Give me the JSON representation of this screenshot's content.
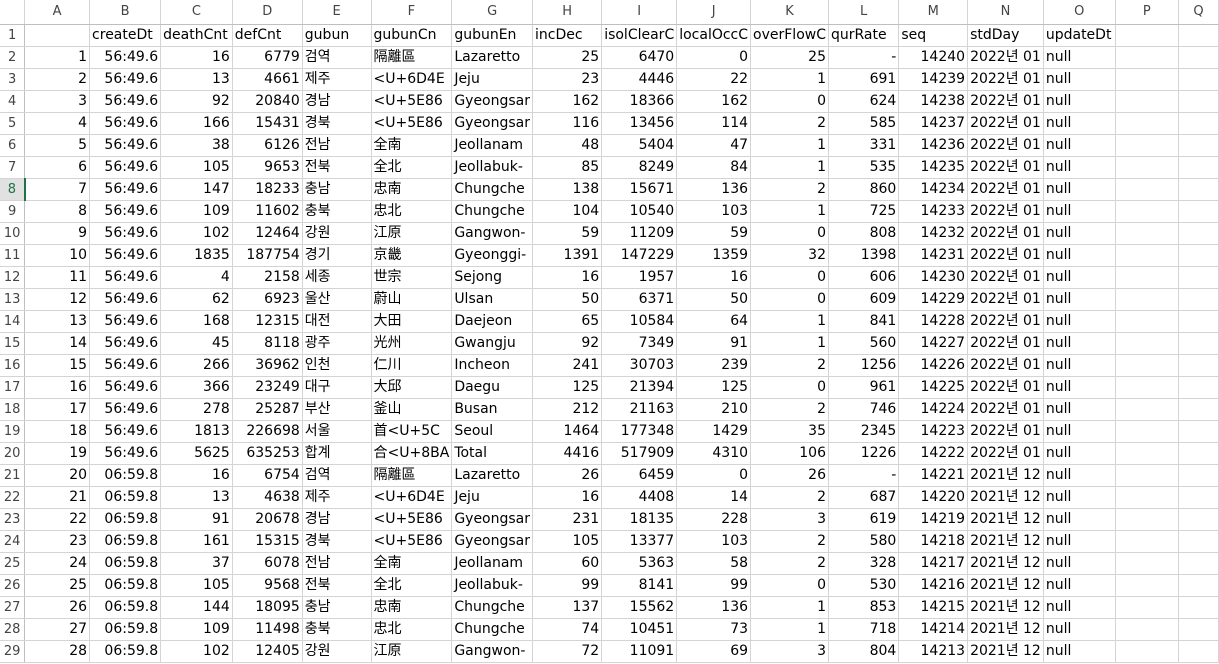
{
  "sheet": {
    "column_letters": [
      "A",
      "B",
      "C",
      "D",
      "E",
      "F",
      "G",
      "H",
      "I",
      "J",
      "K",
      "L",
      "M",
      "N",
      "O",
      "P",
      "Q"
    ],
    "header_row": [
      "",
      "createDt",
      "deathCnt",
      "defCnt",
      "gubun",
      "gubunCn",
      "gubunEn",
      "incDec",
      "isolClearC",
      "localOccC",
      "overFlowC",
      "qurRate",
      "seq",
      "stdDay",
      "updateDt",
      "",
      ""
    ],
    "selected_row": 8,
    "rows": [
      [
        "1",
        "56:49.6",
        "16",
        "6779",
        "검역",
        "隔離區",
        "Lazaretto",
        "25",
        "6470",
        "0",
        "25",
        "-",
        "14240",
        "2022년 01",
        "null"
      ],
      [
        "2",
        "56:49.6",
        "13",
        "4661",
        "제주",
        "<U+6D4E",
        "Jeju",
        "23",
        "4446",
        "22",
        "1",
        "691",
        "14239",
        "2022년 01",
        "null"
      ],
      [
        "3",
        "56:49.6",
        "92",
        "20840",
        "경남",
        "<U+5E86",
        "Gyeongsar",
        "162",
        "18366",
        "162",
        "0",
        "624",
        "14238",
        "2022년 01",
        "null"
      ],
      [
        "4",
        "56:49.6",
        "166",
        "15431",
        "경북",
        "<U+5E86",
        "Gyeongsar",
        "116",
        "13456",
        "114",
        "2",
        "585",
        "14237",
        "2022년 01",
        "null"
      ],
      [
        "5",
        "56:49.6",
        "38",
        "6126",
        "전남",
        "全南",
        "Jeollanam",
        "48",
        "5404",
        "47",
        "1",
        "331",
        "14236",
        "2022년 01",
        "null"
      ],
      [
        "6",
        "56:49.6",
        "105",
        "9653",
        "전북",
        "全北",
        "Jeollabuk-",
        "85",
        "8249",
        "84",
        "1",
        "535",
        "14235",
        "2022년 01",
        "null"
      ],
      [
        "7",
        "56:49.6",
        "147",
        "18233",
        "충남",
        "忠南",
        "Chungche",
        "138",
        "15671",
        "136",
        "2",
        "860",
        "14234",
        "2022년 01",
        "null"
      ],
      [
        "8",
        "56:49.6",
        "109",
        "11602",
        "충북",
        "忠北",
        "Chungche",
        "104",
        "10540",
        "103",
        "1",
        "725",
        "14233",
        "2022년 01",
        "null"
      ],
      [
        "9",
        "56:49.6",
        "102",
        "12464",
        "강원",
        "江原",
        "Gangwon-",
        "59",
        "11209",
        "59",
        "0",
        "808",
        "14232",
        "2022년 01",
        "null"
      ],
      [
        "10",
        "56:49.6",
        "1835",
        "187754",
        "경기",
        "京畿",
        "Gyeonggi-",
        "1391",
        "147229",
        "1359",
        "32",
        "1398",
        "14231",
        "2022년 01",
        "null"
      ],
      [
        "11",
        "56:49.6",
        "4",
        "2158",
        "세종",
        "世宗",
        "Sejong",
        "16",
        "1957",
        "16",
        "0",
        "606",
        "14230",
        "2022년 01",
        "null"
      ],
      [
        "12",
        "56:49.6",
        "62",
        "6923",
        "울산",
        "蔚山",
        "Ulsan",
        "50",
        "6371",
        "50",
        "0",
        "609",
        "14229",
        "2022년 01",
        "null"
      ],
      [
        "13",
        "56:49.6",
        "168",
        "12315",
        "대전",
        "大田",
        "Daejeon",
        "65",
        "10584",
        "64",
        "1",
        "841",
        "14228",
        "2022년 01",
        "null"
      ],
      [
        "14",
        "56:49.6",
        "45",
        "8118",
        "광주",
        "光州",
        "Gwangju",
        "92",
        "7349",
        "91",
        "1",
        "560",
        "14227",
        "2022년 01",
        "null"
      ],
      [
        "15",
        "56:49.6",
        "266",
        "36962",
        "인천",
        "仁川",
        "Incheon",
        "241",
        "30703",
        "239",
        "2",
        "1256",
        "14226",
        "2022년 01",
        "null"
      ],
      [
        "16",
        "56:49.6",
        "366",
        "23249",
        "대구",
        "大邱",
        "Daegu",
        "125",
        "21394",
        "125",
        "0",
        "961",
        "14225",
        "2022년 01",
        "null"
      ],
      [
        "17",
        "56:49.6",
        "278",
        "25287",
        "부산",
        "釜山",
        "Busan",
        "212",
        "21163",
        "210",
        "2",
        "746",
        "14224",
        "2022년 01",
        "null"
      ],
      [
        "18",
        "56:49.6",
        "1813",
        "226698",
        "서울",
        "首<U+5C",
        "Seoul",
        "1464",
        "177348",
        "1429",
        "35",
        "2345",
        "14223",
        "2022년 01",
        "null"
      ],
      [
        "19",
        "56:49.6",
        "5625",
        "635253",
        "합계",
        "合<U+8BA",
        "Total",
        "4416",
        "517909",
        "4310",
        "106",
        "1226",
        "14222",
        "2022년 01",
        "null"
      ],
      [
        "20",
        "06:59.8",
        "16",
        "6754",
        "검역",
        "隔離區",
        "Lazaretto",
        "26",
        "6459",
        "0",
        "26",
        "-",
        "14221",
        "2021년 12",
        "null"
      ],
      [
        "21",
        "06:59.8",
        "13",
        "4638",
        "제주",
        "<U+6D4E",
        "Jeju",
        "16",
        "4408",
        "14",
        "2",
        "687",
        "14220",
        "2021년 12",
        "null"
      ],
      [
        "22",
        "06:59.8",
        "91",
        "20678",
        "경남",
        "<U+5E86",
        "Gyeongsar",
        "231",
        "18135",
        "228",
        "3",
        "619",
        "14219",
        "2021년 12",
        "null"
      ],
      [
        "23",
        "06:59.8",
        "161",
        "15315",
        "경북",
        "<U+5E86",
        "Gyeongsar",
        "105",
        "13377",
        "103",
        "2",
        "580",
        "14218",
        "2021년 12",
        "null"
      ],
      [
        "24",
        "06:59.8",
        "37",
        "6078",
        "전남",
        "全南",
        "Jeollanam",
        "60",
        "5363",
        "58",
        "2",
        "328",
        "14217",
        "2021년 12",
        "null"
      ],
      [
        "25",
        "06:59.8",
        "105",
        "9568",
        "전북",
        "全北",
        "Jeollabuk-",
        "99",
        "8141",
        "99",
        "0",
        "530",
        "14216",
        "2021년 12",
        "null"
      ],
      [
        "26",
        "06:59.8",
        "144",
        "18095",
        "충남",
        "忠南",
        "Chungche",
        "137",
        "15562",
        "136",
        "1",
        "853",
        "14215",
        "2021년 12",
        "null"
      ],
      [
        "27",
        "06:59.8",
        "109",
        "11498",
        "충북",
        "忠北",
        "Chungche",
        "74",
        "10451",
        "73",
        "1",
        "718",
        "14214",
        "2021년 12",
        "null"
      ],
      [
        "28",
        "06:59.8",
        "102",
        "12405",
        "강원",
        "江原",
        "Gangwon-",
        "72",
        "11091",
        "69",
        "3",
        "804",
        "14213",
        "2021년 12",
        "null"
      ]
    ]
  }
}
